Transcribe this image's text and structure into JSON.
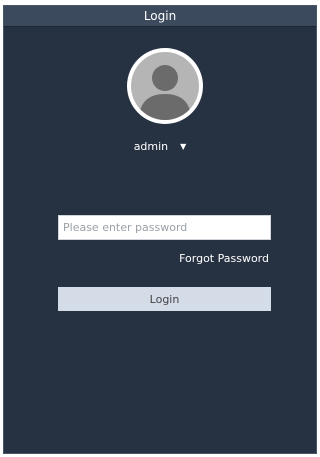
{
  "window": {
    "title": "Login"
  },
  "user": {
    "name": "admin",
    "dropdown_icon": "caret-down-icon",
    "avatar_icon": "user-avatar-icon"
  },
  "password": {
    "placeholder": "Please enter password",
    "value": ""
  },
  "links": {
    "forgot_password": "Forgot Password"
  },
  "actions": {
    "login_label": "Login"
  },
  "colors": {
    "background": "#263142",
    "titlebar": "#3c4a5e",
    "text": "#ffffff",
    "input_bg": "#ffffff",
    "button_bg": "#d4dce7",
    "avatar": "#b5b5b5"
  }
}
